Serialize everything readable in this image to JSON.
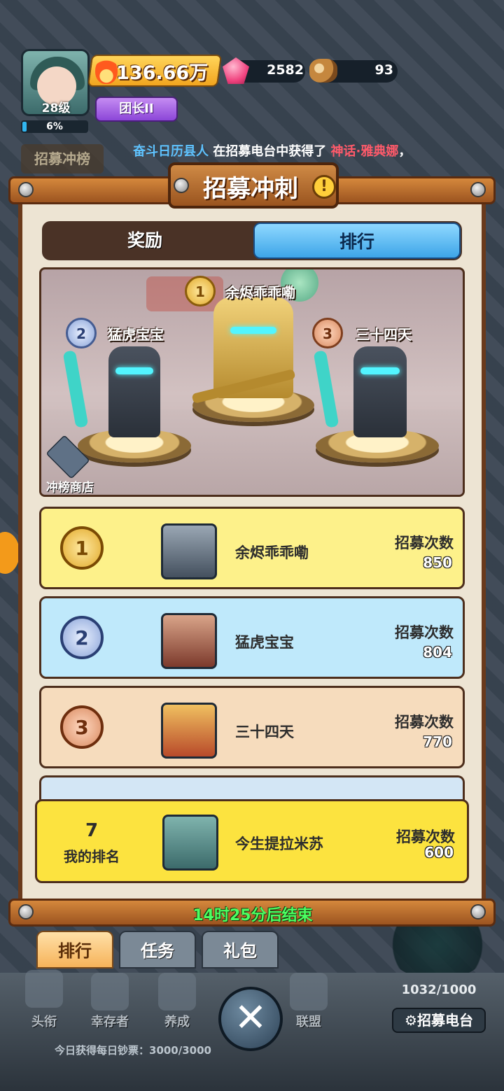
{
  "hud": {
    "level": "28级",
    "exp": "6%",
    "power": "136.66万",
    "gems": "2582",
    "wood": "93",
    "title_badge": "团长II"
  },
  "ticker": {
    "player": "奋斗日历县人",
    "mid": " 在招募电台中获得了 ",
    "item": "神话·雅典娜",
    "tail": "，"
  },
  "bg_tab": "招募冲榜",
  "panel": {
    "title": "招募冲刺",
    "tabs": [
      "奖励",
      "排行"
    ],
    "active_tab": "排行"
  },
  "podium": [
    {
      "rank": "1",
      "name": "余烬乖乖嘞"
    },
    {
      "rank": "2",
      "name": "猛虎宝宝"
    },
    {
      "rank": "3",
      "name": "三十四天"
    }
  ],
  "shop_label": "冲榜商店",
  "rankings": [
    {
      "rank": "1",
      "name": "余烬乖乖嘞",
      "label": "招募次数",
      "value": "850"
    },
    {
      "rank": "2",
      "name": "猛虎宝宝",
      "label": "招募次数",
      "value": "804"
    },
    {
      "rank": "3",
      "name": "三十四天",
      "label": "招募次数",
      "value": "770"
    }
  ],
  "mine": {
    "rank": "7",
    "rank_label": "我的排名",
    "name": "今生提拉米苏",
    "label": "招募次数",
    "value": "600"
  },
  "timer": "14时25分后结束",
  "bottom_tabs": [
    "排行",
    "任务",
    "礼包"
  ],
  "nav": [
    "头衔",
    "幸存者",
    "养成",
    "联盟"
  ],
  "counter": "1032/1000",
  "station": "招募电台",
  "daily": "今日获得每日钞票：3000/3000",
  "colors": {
    "rank1": "#fdf18a",
    "rank2": "#bfe9fb",
    "rank3": "#f6dcbd",
    "mine": "#fce33f",
    "timer": "#4bff61"
  }
}
